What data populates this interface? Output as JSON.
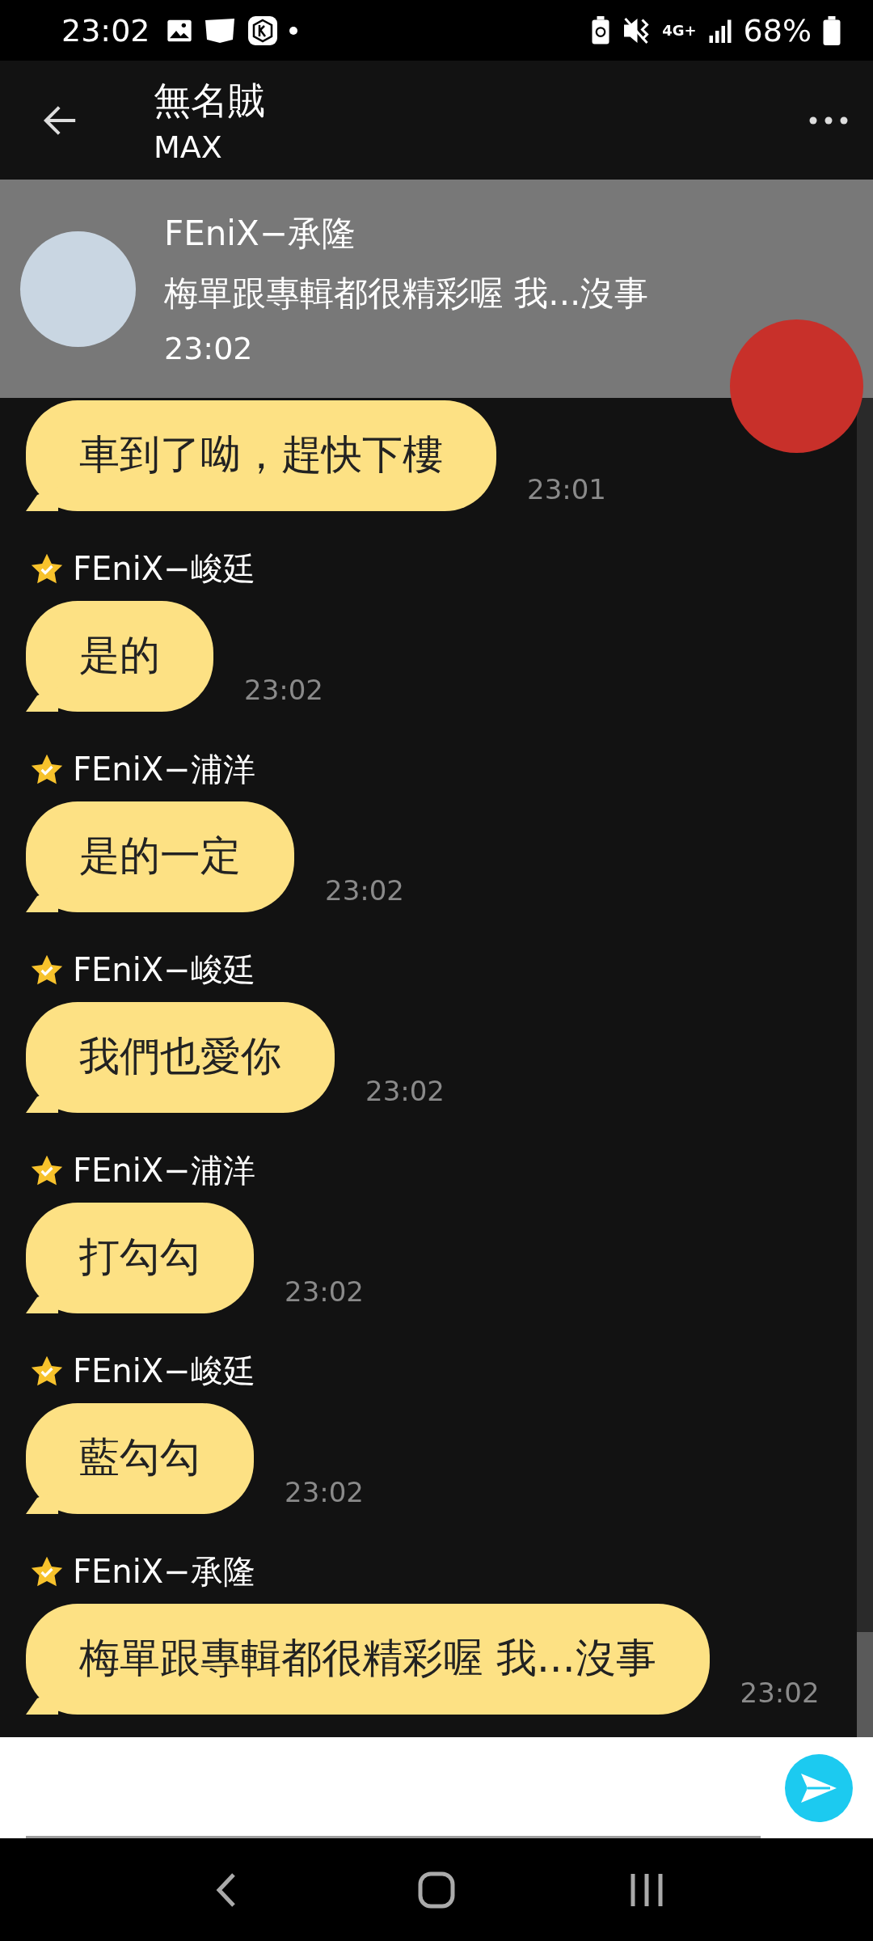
{
  "status_bar": {
    "time": "23:02",
    "network": "4G+",
    "battery": "68%"
  },
  "header": {
    "title": "無名賊",
    "subtitle": "MAX"
  },
  "notification": {
    "sender": "FEniX−承隆",
    "message": "梅單跟專輯都很精彩喔 我...沒事",
    "time": "23:02"
  },
  "messages": [
    {
      "text": "車到了呦，趕快下樓",
      "time": "23:01"
    },
    {
      "sender": "FEniX−峻廷",
      "text": "是的",
      "time": "23:02"
    },
    {
      "sender": "FEniX−浦洋",
      "text": "是的一定",
      "time": "23:02"
    },
    {
      "sender": "FEniX−峻廷",
      "text": "我們也愛你",
      "time": "23:02"
    },
    {
      "sender": "FEniX−浦洋",
      "text": "打勾勾",
      "time": "23:02"
    },
    {
      "sender": "FEniX−峻廷",
      "text": "藍勾勾",
      "time": "23:02"
    },
    {
      "sender": "FEniX−承隆",
      "text": "梅單跟專輯都很精彩喔 我...沒事",
      "time": "23:02"
    }
  ]
}
